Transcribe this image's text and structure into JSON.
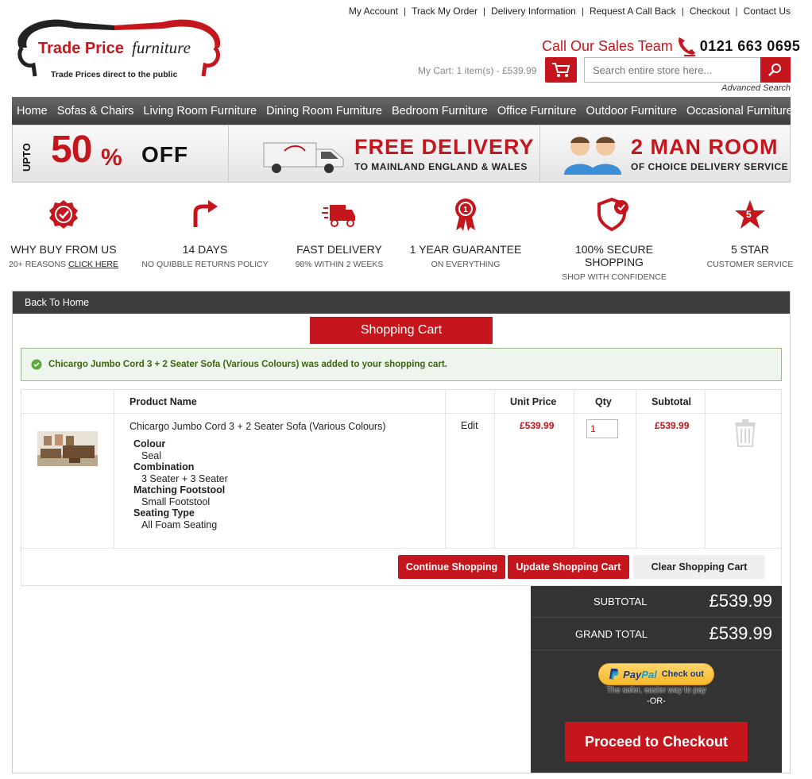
{
  "brand": {
    "name_bold": "Trade Price",
    "name_italic": "furniture",
    "tagline": "Trade Prices direct to the public",
    "accent": "#c4161c"
  },
  "toplinks": [
    "My Account",
    "Track My Order",
    "Delivery Information",
    "Request A Call Back",
    "Checkout",
    "Contact Us"
  ],
  "call": {
    "label": "Call Our Sales Team",
    "number": "0121 663 0695"
  },
  "cart_summary": "My Cart: 1 item(s) - £539.99",
  "search": {
    "placeholder": "Search entire store here...",
    "advanced": "Advanced Search"
  },
  "nav": [
    "Home",
    "Sofas & Chairs",
    "Living Room Furniture",
    "Dining Room Furniture",
    "Bedroom Furniture",
    "Office Furniture",
    "Outdoor Furniture",
    "Occasional Furniture"
  ],
  "promo": {
    "upto": "UPTO",
    "amount": "50",
    "pct": "%",
    "off": "OFF",
    "free_delivery": "FREE DELIVERY",
    "mainland": "TO MAINLAND ENGLAND & WALES",
    "two_man": "2 MAN ROOM",
    "choice": "OF CHOICE DELIVERY SERVICE"
  },
  "features": [
    {
      "icon": "badge-check-icon",
      "title": "WHY BUY FROM US",
      "sub": "20+ REASONS ",
      "link": "CLICK HERE"
    },
    {
      "icon": "return-arrow-icon",
      "title": "14 DAYS",
      "sub": "NO QUIBBLE RETURNS POLICY"
    },
    {
      "icon": "delivery-truck-icon",
      "title": "FAST DELIVERY",
      "sub": "98% WITHIN 2 WEEKS"
    },
    {
      "icon": "award-ribbon-icon",
      "title": "1 YEAR GUARANTEE",
      "sub": "ON EVERYTHING"
    },
    {
      "icon": "shield-check-icon",
      "title": "100% SECURE SHOPPING",
      "sub": "SHOP WITH CONFIDENCE"
    },
    {
      "icon": "star-icon",
      "title": "5 STAR",
      "sub": "CUSTOMER SERVICE"
    }
  ],
  "back_home": "Back To Home",
  "cart_title": "Shopping Cart",
  "success_msg": "Chicargo Jumbo Cord 3 + 2 Seater Sofa (Various Colours) was added to your shopping cart.",
  "table": {
    "headers": {
      "product": "Product Name",
      "unit": "Unit Price",
      "qty": "Qty",
      "subtotal": "Subtotal"
    },
    "item": {
      "name": "Chicargo Jumbo Cord 3 + 2 Seater Sofa (Various Colours)",
      "edit": "Edit",
      "unit_price": "£539.99",
      "qty": "1",
      "subtotal": "£539.99",
      "options": [
        {
          "label": "Colour",
          "value": "Seal"
        },
        {
          "label": "Combination",
          "value": "3 Seater + 3 Seater"
        },
        {
          "label": "Matching Footstool",
          "value": "Small Footstool"
        },
        {
          "label": "Seating Type",
          "value": "All Foam Seating"
        }
      ]
    }
  },
  "buttons": {
    "continue": "Continue Shopping",
    "update": "Update Shopping Cart",
    "clear": "Clear Shopping Cart"
  },
  "totals": {
    "subtotal_label": "SUBTOTAL",
    "subtotal": "£539.99",
    "grand_label": "GRAND TOTAL",
    "grand": "£539.99"
  },
  "paypal": {
    "pay": "Pay",
    "pal": "Pal",
    "checkout": "Check out",
    "tagline": "The safer, easier way to pay",
    "or": "-OR-"
  },
  "proceed": "Proceed to Checkout"
}
